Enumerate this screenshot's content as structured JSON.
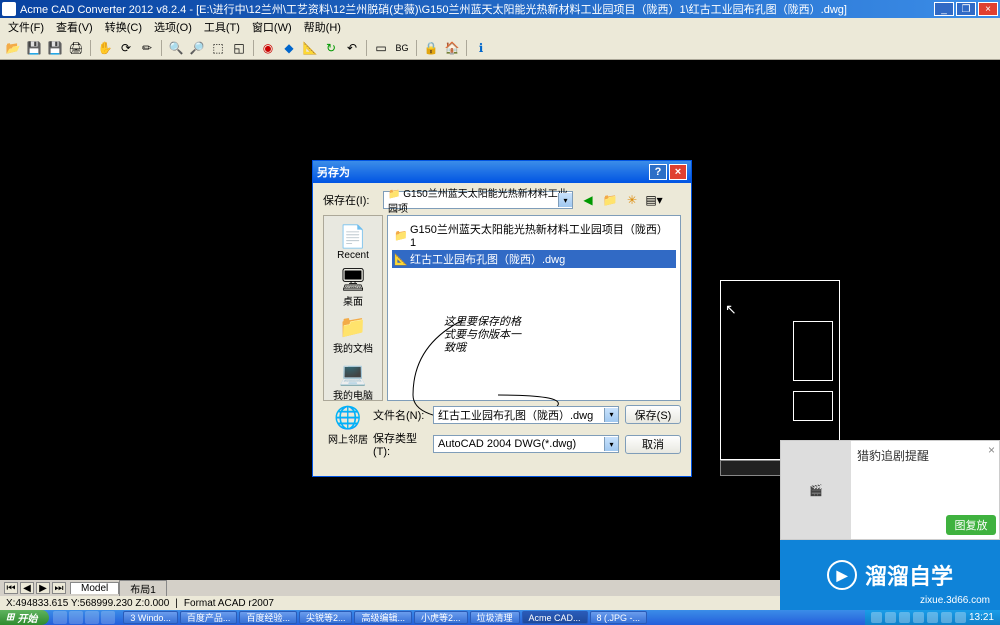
{
  "app": {
    "title": "Acme CAD Converter 2012 v8.2.4 - [E:\\进行中\\12兰州\\工艺资料\\12兰州脱硝(史薇)\\G150兰州蓝天太阳能光热新材料工业园项目（陇西）1\\红古工业园布孔图（陇西）.dwg]"
  },
  "menu": {
    "file": "文件(F)",
    "view": "查看(V)",
    "convert": "转换(C)",
    "options": "选项(O)",
    "tools": "工具(T)",
    "window": "窗口(W)",
    "help": "帮助(H)"
  },
  "dialog": {
    "title": "另存为",
    "save_in_label": "保存在(I):",
    "save_in_value": "G150兰州蓝天太阳能光热新材料工业园项",
    "folder_item": "G150兰州蓝天太阳能光热新材料工业园项目（陇西）1",
    "file_item": "红古工业园布孔图（陇西）.dwg",
    "annotation_l1": "这里要保存的格",
    "annotation_l2": "式要与你版本一",
    "annotation_l3": "致哦",
    "filename_label": "文件名(N):",
    "filename_value": "红古工业园布孔图（陇西）.dwg",
    "filetype_label": "保存类型(T):",
    "filetype_value": "AutoCAD 2004 DWG(*.dwg)",
    "save_btn": "保存(S)",
    "cancel_btn": "取消"
  },
  "places": {
    "recent": "Recent",
    "desktop": "桌面",
    "mydocs": "我的文档",
    "mycomputer": "我的电脑",
    "network": "网上邻居"
  },
  "tabs": {
    "model": "Model",
    "layout1": "布局1"
  },
  "status": {
    "coords": "X:494833.615 Y:568999.230 Z:0.000",
    "format": "Format ACAD r2007"
  },
  "taskbar": {
    "start": "开始",
    "t1": "3 Windo...",
    "t2": "百度产品...",
    "t3": "百度经验...",
    "t4": "尖锐等2...",
    "t5": "高级编辑...",
    "t6": "小虎等2...",
    "t7": "垃圾清理",
    "t8": "Acme CAD...",
    "t9": "8 (.JPG -...",
    "clock": "13:21"
  },
  "popup": {
    "title": "猎豹追剧提醒"
  },
  "watermark": {
    "brand": "溜溜自学",
    "url": "zixue.3d66.com"
  },
  "green_btn": "图复放"
}
